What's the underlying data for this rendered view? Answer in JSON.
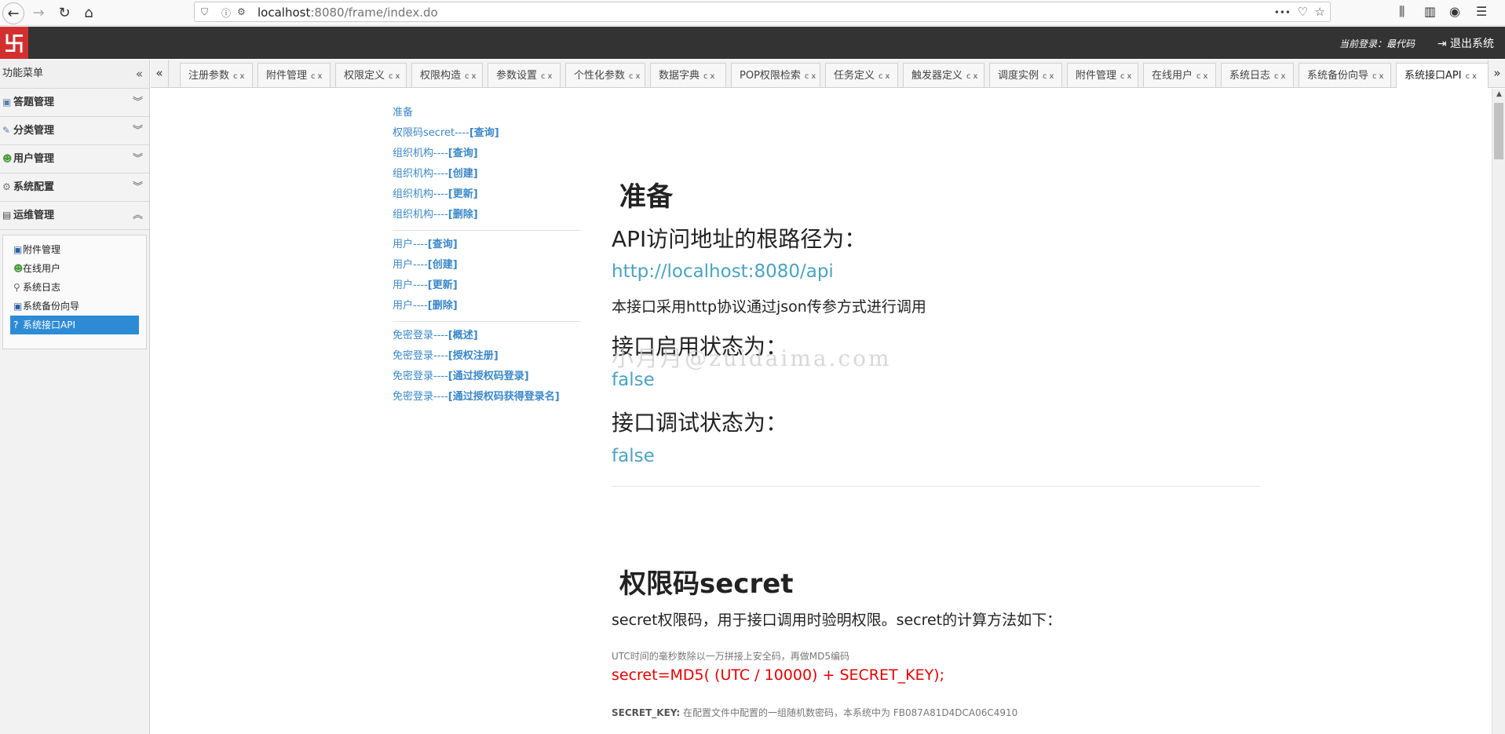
{
  "browser": {
    "url_host": "localhost",
    "url_rest": ":8080/frame/index.do",
    "more": "•••"
  },
  "header": {
    "logo_text": "卐",
    "current_user_label": "当前登录：最代码",
    "logout_label": "退出系统"
  },
  "sidebar": {
    "title": "功能菜单",
    "groups": [
      {
        "label": "答题管理"
      },
      {
        "label": "分类管理"
      },
      {
        "label": "用户管理"
      },
      {
        "label": "系统配置"
      },
      {
        "label": "运维管理"
      }
    ],
    "sub_items": [
      {
        "label": "附件管理"
      },
      {
        "label": "在线用户"
      },
      {
        "label": "系统日志"
      },
      {
        "label": "系统备份向导"
      },
      {
        "label": "系统接口API"
      }
    ]
  },
  "tabs": [
    {
      "label": "注册参数"
    },
    {
      "label": "附件管理"
    },
    {
      "label": "权限定义"
    },
    {
      "label": "权限构造"
    },
    {
      "label": "参数设置"
    },
    {
      "label": "个性化参数"
    },
    {
      "label": "数据字典"
    },
    {
      "label": "POP权限检索"
    },
    {
      "label": "任务定义"
    },
    {
      "label": "触发器定义"
    },
    {
      "label": "调度实例"
    },
    {
      "label": "附件管理"
    },
    {
      "label": "在线用户"
    },
    {
      "label": "系统日志"
    },
    {
      "label": "系统备份向导"
    },
    {
      "label": "系统接口API"
    }
  ],
  "tab_reload_glyph": "c",
  "tab_close_glyph": "x",
  "toc": {
    "group1": [
      {
        "pre": "准备",
        "bold": ""
      },
      {
        "pre": "权限码secret----",
        "bold": "[查询]"
      },
      {
        "pre": "组织机构----",
        "bold": "[查询]"
      },
      {
        "pre": "组织机构----",
        "bold": "[创建]"
      },
      {
        "pre": "组织机构----",
        "bold": "[更新]"
      },
      {
        "pre": "组织机构----",
        "bold": "[删除]"
      }
    ],
    "group2": [
      {
        "pre": "用户----",
        "bold": "[查询]"
      },
      {
        "pre": "用户----",
        "bold": "[创建]"
      },
      {
        "pre": "用户----",
        "bold": "[更新]"
      },
      {
        "pre": "用户----",
        "bold": "[删除]"
      }
    ],
    "group3": [
      {
        "pre": "免密登录----",
        "bold": "[概述]"
      },
      {
        "pre": "免密登录----",
        "bold": "[授权注册]"
      },
      {
        "pre": "免密登录----",
        "bold": "[通过授权码登录]"
      },
      {
        "pre": "免密登录----",
        "bold": "[通过授权码获得登录名]"
      }
    ]
  },
  "main": {
    "sec1_title": "准备",
    "root_label": "API访问地址的根路径为：",
    "root_url": "http://localhost:8080/api",
    "protocol_text": "本接口采用http协议通过json传参方式进行调用",
    "enabled_label": "接口启用状态为：",
    "enabled_value": "false",
    "debug_label": "接口调试状态为：",
    "debug_value": "false",
    "sec2_title": "权限码secret",
    "secret_desc": "secret权限码，用于接口调用时验明权限。secret的计算方法如下：",
    "utc_note": "UTC时间的毫秒数除以一万拼接上安全码，再做MD5编码",
    "formula": "secret=MD5( (UTC / 10000) + SECRET_KEY);",
    "key_label": "SECRET_KEY:",
    "key_desc": " 在配置文件中配置的一组随机数密码，本系统中为 FB087A81D4DCA06C4910",
    "watermark": "小月月@zuidaima.com"
  }
}
